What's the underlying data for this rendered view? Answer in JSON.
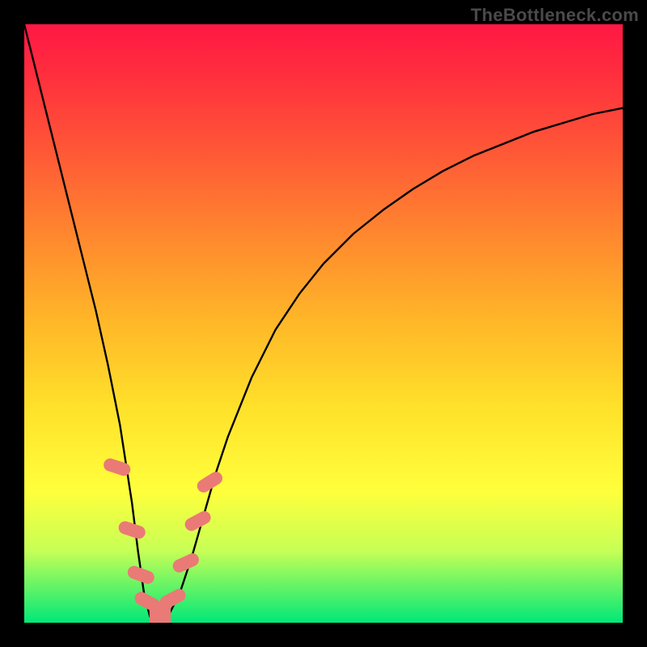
{
  "watermark": "TheBottleneck.com",
  "chart_data": {
    "type": "line",
    "title": "",
    "xlabel": "",
    "ylabel": "",
    "xlim": [
      0,
      100
    ],
    "ylim": [
      0,
      100
    ],
    "grid": false,
    "legend": false,
    "x": [
      0,
      2,
      4,
      6,
      8,
      10,
      12,
      14,
      16,
      18,
      19,
      20,
      21,
      22,
      23,
      24,
      26,
      28,
      30,
      32,
      34,
      38,
      42,
      46,
      50,
      55,
      60,
      65,
      70,
      75,
      80,
      85,
      90,
      95,
      100
    ],
    "values": [
      100,
      92,
      84,
      76,
      68,
      60,
      52,
      43,
      33,
      20,
      12,
      5,
      1,
      0,
      0,
      1,
      5,
      11,
      18,
      25,
      31,
      41,
      49,
      55,
      60,
      65,
      69,
      72.5,
      75.5,
      78,
      80,
      82,
      83.5,
      85,
      86
    ],
    "series": [
      {
        "name": "curve",
        "style": "solid",
        "color": "#000000",
        "x": [
          0,
          2,
          4,
          6,
          8,
          10,
          12,
          14,
          16,
          18,
          19,
          20,
          21,
          22,
          23,
          24,
          26,
          28,
          30,
          32,
          34,
          38,
          42,
          46,
          50,
          55,
          60,
          65,
          70,
          75,
          80,
          85,
          90,
          95,
          100
        ],
        "y": [
          100,
          92,
          84,
          76,
          68,
          60,
          52,
          43,
          33,
          20,
          12,
          5,
          1,
          0,
          0,
          1,
          5,
          11,
          18,
          25,
          31,
          41,
          49,
          55,
          60,
          65,
          69,
          72.5,
          75.5,
          78,
          80,
          82,
          83.5,
          85,
          86
        ]
      }
    ],
    "markers": {
      "color": "#ea7a76",
      "shape": "rounded-bar",
      "points": [
        {
          "x": 15.5,
          "y": 26,
          "angle": -72
        },
        {
          "x": 18.0,
          "y": 15.5,
          "angle": -72
        },
        {
          "x": 19.5,
          "y": 8.0,
          "angle": -70
        },
        {
          "x": 20.6,
          "y": 3.5,
          "angle": -62
        },
        {
          "x": 22.0,
          "y": 1.0,
          "angle": 0
        },
        {
          "x": 23.4,
          "y": 1.0,
          "angle": 0
        },
        {
          "x": 24.8,
          "y": 4.0,
          "angle": 62
        },
        {
          "x": 27.0,
          "y": 10.0,
          "angle": 65
        },
        {
          "x": 29.0,
          "y": 17.0,
          "angle": 62
        },
        {
          "x": 31.0,
          "y": 23.5,
          "angle": 58
        }
      ]
    }
  }
}
